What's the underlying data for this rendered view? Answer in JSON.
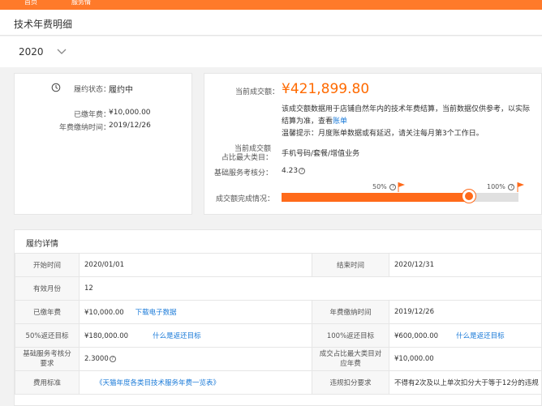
{
  "topbar": {
    "nav_items": [
      "首页",
      "服务情"
    ]
  },
  "page_title": "技术年费明细",
  "year_selector": {
    "value": "2020"
  },
  "status_card": {
    "status_label": "履约状态：",
    "status_value": "履约中",
    "paid_fee_label": "已缴年费：",
    "paid_fee_value": "¥10,000.00",
    "paid_time_label": "年费缴纳时间：",
    "paid_time_value": "2019/12/26"
  },
  "deal_card": {
    "amount_label": "当前成交额：",
    "amount_value": "¥421,899.80",
    "note_line1": "该成交额数据用于店铺自然年内的技术年费结算，当前数据仅供参考，以实际",
    "note_line2_prefix": "结算为准，查看",
    "note_line2_link": "账单",
    "tip": "温馨提示：月度账单数据或有延迟，请关注每月第3个工作日。",
    "category_label_line1": "当前成交额",
    "category_label_line2": "占比最大类目：",
    "category_value": "手机号码/套餐/增值业务",
    "score_label": "基础服务考核分：",
    "score_value": "4.23",
    "progress_label": "成交额完成情况：",
    "progress_fraction": 0.79,
    "milestone_50": "50%",
    "milestone_100": "100%"
  },
  "details": {
    "heading": "履约详情",
    "rows": [
      [
        {
          "k": "开始时间",
          "v": "2020/01/01"
        },
        {
          "k": "结束时间",
          "v": "2020/12/31"
        }
      ],
      [
        {
          "k": "有效月份",
          "v": "12"
        }
      ],
      [
        {
          "k": "已缴年费",
          "v": "¥10,000.00",
          "link": "下载电子数据"
        },
        {
          "k": "年费缴纳时间",
          "v": "2019/12/26"
        }
      ],
      [
        {
          "k": "50%返还目标",
          "v": "¥180,000.00",
          "link": "什么是返还目标"
        },
        {
          "k": "100%返还目标",
          "v": "¥600,000.00",
          "link": "什么是返还目标"
        }
      ],
      [
        {
          "k": "基础服务考核分要求",
          "v": "2.3000"
        },
        {
          "k": "成交占比最大类目对应年费",
          "v": "¥10,000.00"
        }
      ],
      [
        {
          "k": "费用标准",
          "v": "",
          "link": "《天猫年度各类目技术服务年费一览表》"
        },
        {
          "k": "违规扣分要求",
          "v": "不得有2次及以上单次扣分大于等于12分的违规"
        }
      ]
    ]
  },
  "colors": {
    "brand": "#ff7a2a",
    "accent_orange": "#ff6a00",
    "link": "#1a7ad8"
  }
}
